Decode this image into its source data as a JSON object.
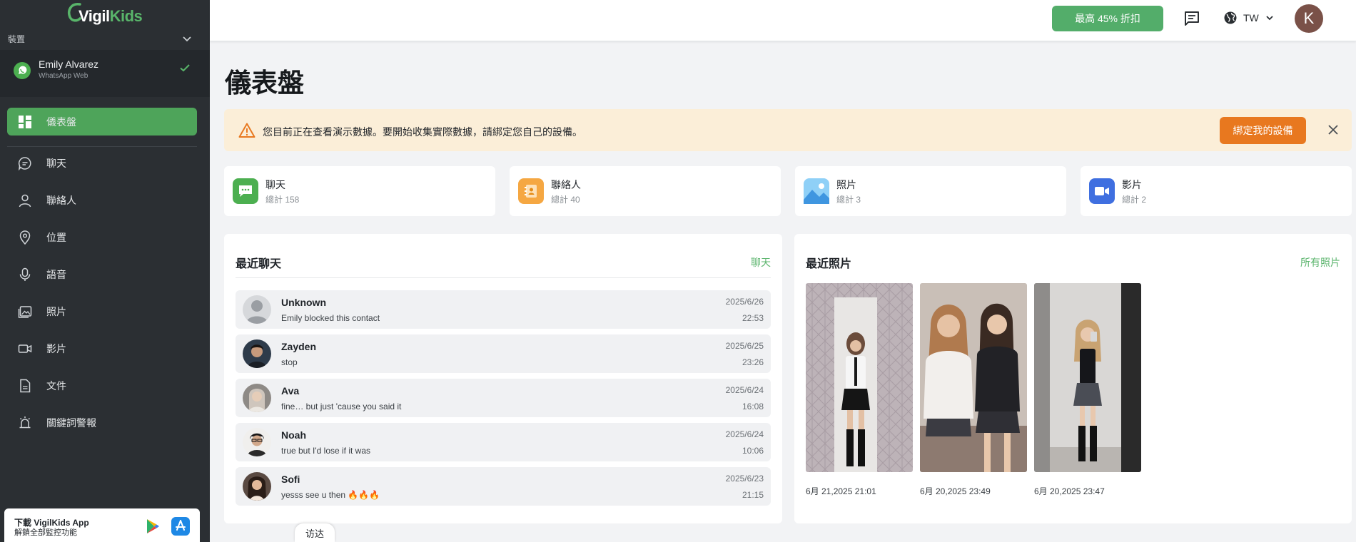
{
  "app": {
    "brand_v": "Vigil",
    "brand_k": "Kids"
  },
  "sidebar": {
    "device_section_label": "裝置",
    "device": {
      "name": "Emily Alvarez",
      "subtitle": "WhatsApp Web"
    },
    "items": [
      {
        "label": "儀表盤",
        "icon": "dashboard-icon",
        "active": true
      },
      {
        "label": "聊天",
        "icon": "chat-icon"
      },
      {
        "label": "聯絡人",
        "icon": "contacts-icon"
      },
      {
        "label": "位置",
        "icon": "location-icon"
      },
      {
        "label": "語音",
        "icon": "microphone-icon"
      },
      {
        "label": "照片",
        "icon": "photo-icon"
      },
      {
        "label": "影片",
        "icon": "video-icon"
      },
      {
        "label": "文件",
        "icon": "document-icon"
      },
      {
        "label": "關鍵詞警報",
        "icon": "alarm-icon"
      }
    ],
    "app_promo": {
      "title": "下載 VigilKids App",
      "subtitle": "解鎖全部監控功能"
    }
  },
  "topbar": {
    "promo_label": "最高 45% 折扣",
    "language": "TW",
    "avatar_letter": "K"
  },
  "main": {
    "title": "儀表盤",
    "notice": {
      "text": "您目前正在查看演示數據。要開始收集實際數據，請綁定您自己的設備。",
      "button": "綁定我的設備"
    },
    "stats": [
      {
        "name": "聊天",
        "count": "總計 158",
        "icon": "chat-stat-icon",
        "color": "#4caf50"
      },
      {
        "name": "聯絡人",
        "count": "總計 40",
        "icon": "contacts-stat-icon",
        "color": "#f5a742"
      },
      {
        "name": "照片",
        "count": "總計 3",
        "icon": "photo-stat-icon",
        "color": "#5aaeea"
      },
      {
        "name": "影片",
        "count": "總計 2",
        "icon": "video-stat-icon",
        "color": "#3f6fe0"
      }
    ],
    "recent_chats": {
      "title": "最近聊天",
      "link": "聊天",
      "rows": [
        {
          "name": "Unknown",
          "message": "Emily blocked this contact",
          "date": "2025/6/26",
          "time": "22:53"
        },
        {
          "name": "Zayden",
          "message": "stop",
          "date": "2025/6/25",
          "time": "23:26"
        },
        {
          "name": "Ava",
          "message": "fine… but just 'cause you said it",
          "date": "2025/6/24",
          "time": "16:08"
        },
        {
          "name": "Noah",
          "message": "true but I'd lose if it was",
          "date": "2025/6/24",
          "time": "10:06"
        },
        {
          "name": "Sofi",
          "message": "yesss see u then 🔥🔥🔥",
          "date": "2025/6/23",
          "time": "21:15"
        }
      ]
    },
    "recent_photos": {
      "title": "最近照片",
      "link": "所有照片",
      "items": [
        {
          "date": "6月 21,2025 21:01"
        },
        {
          "date": "6月 20,2025 23:49"
        },
        {
          "date": "6月 20,2025 23:47"
        }
      ]
    }
  },
  "visit_tab": "访达"
}
